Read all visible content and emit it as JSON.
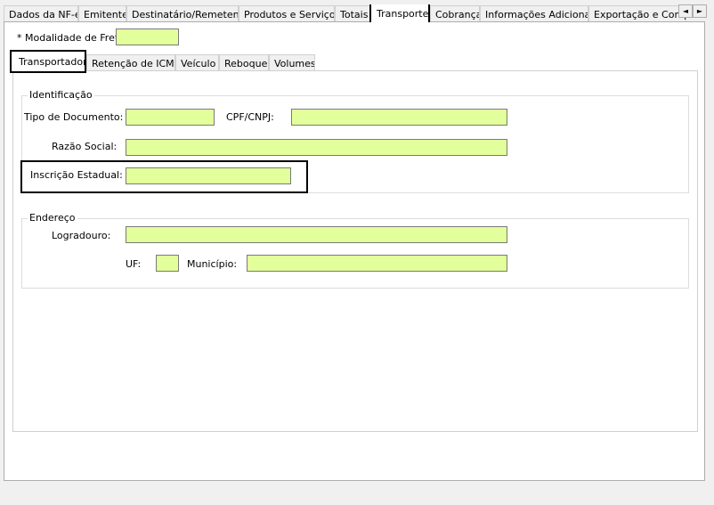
{
  "tabs": [
    {
      "label": "Dados da NF-e"
    },
    {
      "label": "Emitente"
    },
    {
      "label": "Destinatário/Remetente"
    },
    {
      "label": "Produtos e Serviços"
    },
    {
      "label": "Totais"
    },
    {
      "label": "Transporte"
    },
    {
      "label": "Cobrança"
    },
    {
      "label": "Informações Adicionais"
    },
    {
      "label": "Exportação e Compras"
    }
  ],
  "tab_scroll": {
    "left": "◄",
    "right": "►"
  },
  "modalidade": {
    "label": "* Modalidade de Frete:",
    "value": ""
  },
  "subtabs": [
    {
      "label": "Transportador"
    },
    {
      "label": "Retenção de ICMS"
    },
    {
      "label": "Veículo"
    },
    {
      "label": "Reboque"
    },
    {
      "label": "Volumes"
    }
  ],
  "identificacao": {
    "title": "Identificação",
    "tipo_documento": {
      "label": "Tipo de Documento:",
      "value": ""
    },
    "cpf_cnpj": {
      "label": "CPF/CNPJ:",
      "value": ""
    },
    "razao_social": {
      "label": "Razão Social:",
      "value": ""
    },
    "inscricao_estadual": {
      "label": "Inscrição Estadual:",
      "value": ""
    }
  },
  "endereco": {
    "title": "Endereço",
    "logradouro": {
      "label": "Logradouro:",
      "value": ""
    },
    "uf": {
      "label": "UF:",
      "value": ""
    },
    "municipio": {
      "label": "Município:",
      "value": ""
    }
  },
  "colors": {
    "field_bg": "#e3ff9b",
    "highlight": "#000000"
  }
}
